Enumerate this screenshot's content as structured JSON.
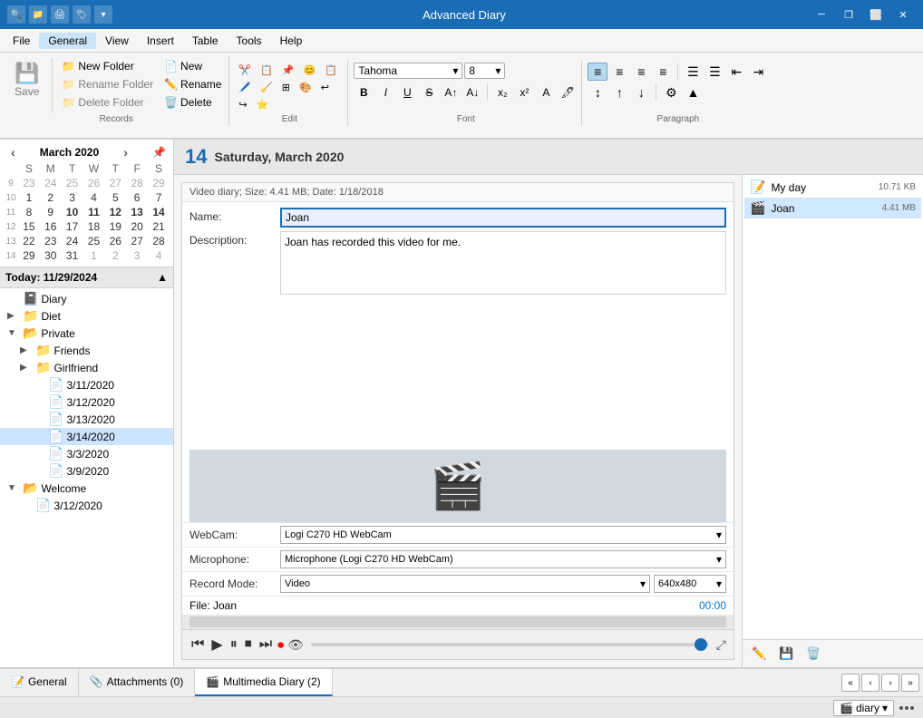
{
  "app": {
    "title": "Advanced Diary"
  },
  "titlebar": {
    "icons": [
      "🔍",
      "📁",
      "🖨",
      "🏷",
      "▼"
    ],
    "controls": [
      "⬜",
      "❐",
      "─",
      "✕"
    ]
  },
  "menubar": {
    "items": [
      "File",
      "General",
      "View",
      "Insert",
      "Table",
      "Tools",
      "Help"
    ],
    "active": "General"
  },
  "ribbon": {
    "records_group": {
      "label": "Records",
      "save_label": "Save",
      "new_folder_label": "New Folder",
      "new_label": "New",
      "rename_folder_label": "Rename Folder",
      "rename_label": "Rename",
      "delete_folder_label": "Delete Folder",
      "delete_label": "Delete"
    },
    "edit_group": {
      "label": "Edit"
    },
    "font_group": {
      "label": "Font",
      "font_name": "Tahoma",
      "font_size": "8"
    },
    "paragraph_group": {
      "label": "Paragraph"
    }
  },
  "calendar": {
    "month_year": "March 2020",
    "days": [
      "S",
      "M",
      "T",
      "W",
      "T",
      "F",
      "S"
    ],
    "weeks": [
      {
        "week": "9",
        "days": [
          "23",
          "24",
          "25",
          "26",
          "27",
          "28",
          "29"
        ]
      },
      {
        "week": "10",
        "days": [
          "1",
          "2",
          "3",
          "4",
          "5",
          "6",
          "7"
        ]
      },
      {
        "week": "11",
        "days": [
          "8",
          "9",
          "10",
          "11",
          "12",
          "13",
          "14"
        ]
      },
      {
        "week": "12",
        "days": [
          "15",
          "16",
          "17",
          "18",
          "19",
          "20",
          "21"
        ]
      },
      {
        "week": "13",
        "days": [
          "22",
          "23",
          "24",
          "25",
          "26",
          "27",
          "28"
        ]
      },
      {
        "week": "14",
        "days": [
          "29",
          "30",
          "31",
          "1",
          "2",
          "3",
          "4"
        ]
      }
    ]
  },
  "sidebar": {
    "today_label": "Today: 11/29/2024",
    "tree": [
      {
        "id": "diary",
        "label": "Diary",
        "level": 0,
        "icon": "📓",
        "toggle": "",
        "expanded": false
      },
      {
        "id": "diet",
        "label": "Diet",
        "level": 0,
        "icon": "📁",
        "toggle": "▶",
        "expanded": false
      },
      {
        "id": "private",
        "label": "Private",
        "level": 0,
        "icon": "📂",
        "toggle": "▼",
        "expanded": true
      },
      {
        "id": "friends",
        "label": "Friends",
        "level": 1,
        "icon": "📁",
        "toggle": "▶",
        "expanded": false
      },
      {
        "id": "girlfriend",
        "label": "Girlfriend",
        "level": 1,
        "icon": "📁",
        "toggle": "▶",
        "expanded": false
      },
      {
        "id": "e1",
        "label": "3/11/2020",
        "level": 2,
        "icon": "📄",
        "toggle": "",
        "expanded": false
      },
      {
        "id": "e2",
        "label": "3/12/2020",
        "level": 2,
        "icon": "📄",
        "toggle": "",
        "expanded": false
      },
      {
        "id": "e3",
        "label": "3/13/2020",
        "level": 2,
        "icon": "📄",
        "toggle": "",
        "expanded": false
      },
      {
        "id": "e4",
        "label": "3/14/2020",
        "level": 2,
        "icon": "📄",
        "toggle": "",
        "expanded": false,
        "selected": true
      },
      {
        "id": "e5",
        "label": "3/3/2020",
        "level": 2,
        "icon": "📄",
        "toggle": "",
        "expanded": false
      },
      {
        "id": "e6",
        "label": "3/9/2020",
        "level": 2,
        "icon": "📄",
        "toggle": "",
        "expanded": false
      },
      {
        "id": "welcome",
        "label": "Welcome",
        "level": 0,
        "icon": "📂",
        "toggle": "▼",
        "expanded": true
      },
      {
        "id": "w1",
        "label": "3/12/2020",
        "level": 1,
        "icon": "📄",
        "toggle": "",
        "expanded": false
      }
    ]
  },
  "entry": {
    "date_number": "14",
    "date_text": "Saturday, March 2020",
    "info_bar": "Video diary;  Size: 4.41 MB;  Date: 1/18/2018",
    "name_label": "Name:",
    "name_value": "Joan",
    "description_label": "Description:",
    "description_value": "Joan has recorded this video for me.",
    "webcam_label": "WebCam:",
    "webcam_value": "Logi C270 HD WebCam",
    "microphone_label": "Microphone:",
    "microphone_value": "Microphone (Logi C270 HD WebCam)",
    "record_mode_label": "Record Mode:",
    "record_mode_value": "Video",
    "resolution_value": "640x480",
    "file_label": "File: Joan",
    "file_time": "00:00",
    "webcam_options": [
      "Logi C270 HD WebCam"
    ],
    "microphone_options": [
      "Microphone (Logi C270 HD WebCam)"
    ],
    "record_mode_options": [
      "Video"
    ],
    "resolution_options": [
      "640x480"
    ]
  },
  "media_list": {
    "items": [
      {
        "name": "My day",
        "size": "10.71 KB",
        "icon": "📝"
      },
      {
        "name": "Joan",
        "size": "4.41 MB",
        "icon": "🎬",
        "selected": true
      }
    ]
  },
  "tabs": {
    "items": [
      {
        "label": "General",
        "icon": "📝",
        "active": false
      },
      {
        "label": "Attachments (0)",
        "icon": "📎",
        "active": false
      },
      {
        "label": "Multimedia Diary (2)",
        "icon": "🎬",
        "active": true
      }
    ]
  },
  "statusbar": {
    "dropdown_label": "diary"
  }
}
